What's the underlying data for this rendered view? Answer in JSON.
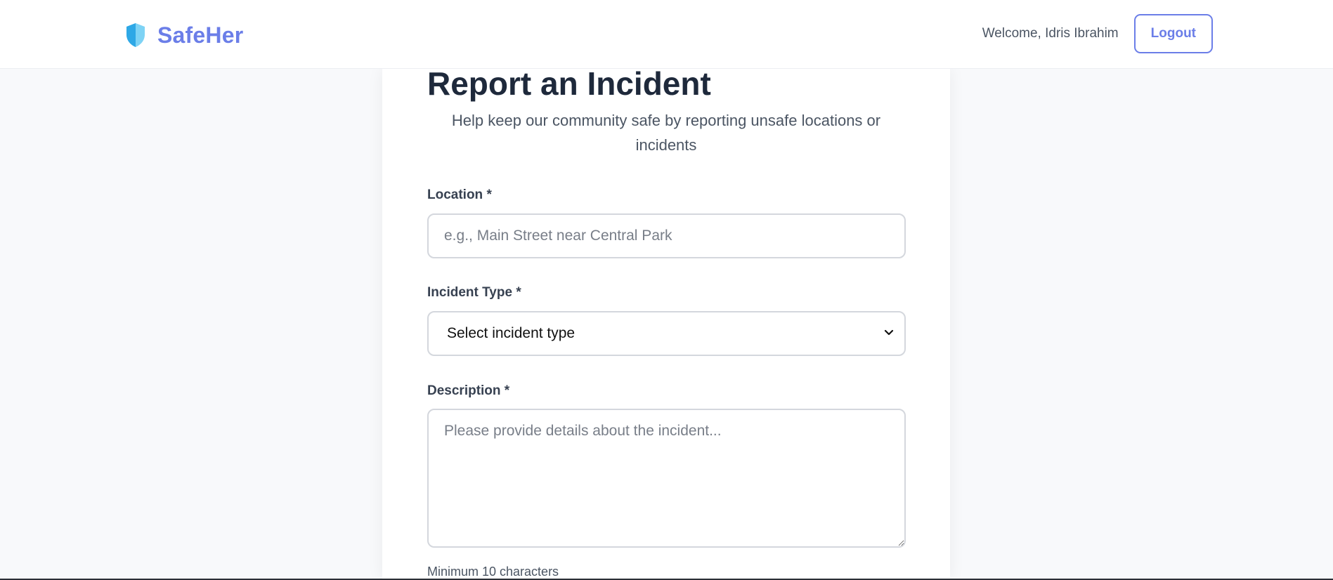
{
  "nav": {
    "brand": "SafeHer",
    "welcome": "Welcome, Idris Ibrahim",
    "logout_label": "Logout",
    "icon": "shield-icon"
  },
  "colors": {
    "brand": "#6b7ee8",
    "shield_light": "#7ed3f5",
    "shield_dark": "#2ea8e6",
    "background": "#f8f9fb"
  },
  "form": {
    "title": "Report an Incident",
    "subtitle": "Help keep our community safe by reporting unsafe locations or incidents",
    "location": {
      "label": "Location *",
      "placeholder": "e.g., Main Street near Central Park",
      "value": ""
    },
    "incident_type": {
      "label": "Incident Type *",
      "selected": "Select incident type"
    },
    "description": {
      "label": "Description *",
      "placeholder": "Please provide details about the incident...",
      "value": "",
      "hint": "Minimum 10 characters"
    }
  }
}
